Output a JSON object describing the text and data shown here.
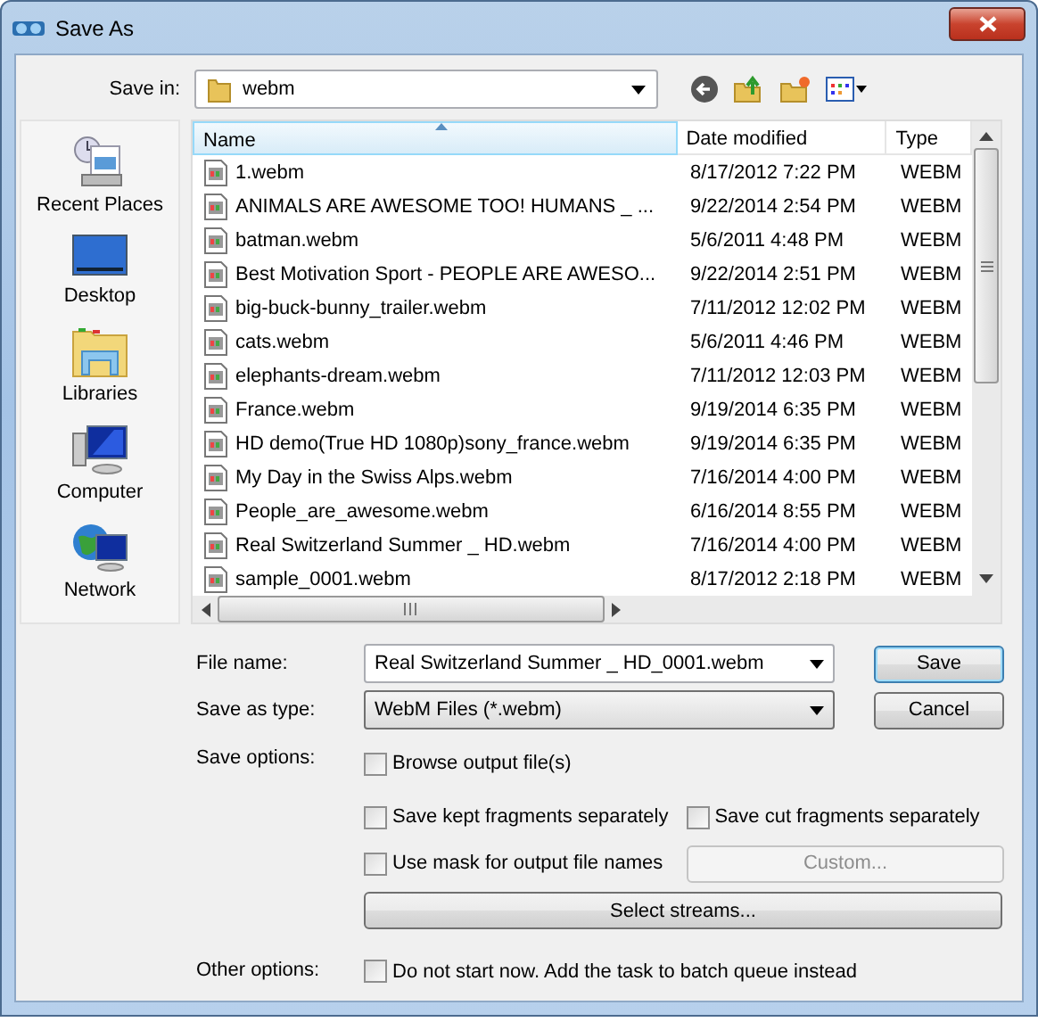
{
  "window": {
    "title": "Save As"
  },
  "save_in": {
    "label": "Save in:",
    "value": "webm"
  },
  "places": [
    {
      "label": "Recent Places",
      "kind": "recent"
    },
    {
      "label": "Desktop",
      "kind": "desktop"
    },
    {
      "label": "Libraries",
      "kind": "libraries"
    },
    {
      "label": "Computer",
      "kind": "computer"
    },
    {
      "label": "Network",
      "kind": "network"
    }
  ],
  "file_list": {
    "columns": [
      {
        "label": "Name",
        "sorted": true
      },
      {
        "label": "Date modified",
        "sorted": false
      },
      {
        "label": "Type",
        "sorted": false
      }
    ],
    "rows": [
      {
        "name": "1.webm",
        "date": "8/17/2012 7:22 PM",
        "type": "WEBM"
      },
      {
        "name": "ANIMALS ARE AWESOME TOO! HUMANS _ ...",
        "date": "9/22/2014 2:54 PM",
        "type": "WEBM"
      },
      {
        "name": "batman.webm",
        "date": "5/6/2011 4:48 PM",
        "type": "WEBM"
      },
      {
        "name": "Best Motivation Sport - PEOPLE ARE AWESO...",
        "date": "9/22/2014 2:51 PM",
        "type": "WEBM"
      },
      {
        "name": "big-buck-bunny_trailer.webm",
        "date": "7/11/2012 12:02 PM",
        "type": "WEBM"
      },
      {
        "name": "cats.webm",
        "date": "5/6/2011 4:46 PM",
        "type": "WEBM"
      },
      {
        "name": "elephants-dream.webm",
        "date": "7/11/2012 12:03 PM",
        "type": "WEBM"
      },
      {
        "name": "France.webm",
        "date": "9/19/2014 6:35 PM",
        "type": "WEBM"
      },
      {
        "name": "HD demo(True HD 1080p)sony_france.webm",
        "date": "9/19/2014 6:35 PM",
        "type": "WEBM"
      },
      {
        "name": "My Day in the Swiss Alps.webm",
        "date": "7/16/2014 4:00 PM",
        "type": "WEBM"
      },
      {
        "name": "People_are_awesome.webm",
        "date": "6/16/2014 8:55 PM",
        "type": "WEBM"
      },
      {
        "name": "Real Switzerland Summer _ HD.webm",
        "date": "7/16/2014 4:00 PM",
        "type": "WEBM"
      },
      {
        "name": "sample_0001.webm",
        "date": "8/17/2012 2:18 PM",
        "type": "WEBM"
      }
    ]
  },
  "file_name": {
    "label": "File name:",
    "value": "Real Switzerland Summer _ HD_0001.webm"
  },
  "save_as_type": {
    "label": "Save as type:",
    "value": "WebM Files (*.webm)"
  },
  "buttons": [
    {
      "label": "Save",
      "default": true
    },
    {
      "label": "Cancel",
      "default": false
    }
  ],
  "save_options": {
    "label": "Save options:",
    "browse": {
      "label": "Browse output file(s)",
      "checked": false
    },
    "kept": {
      "label": "Save kept fragments separately",
      "checked": false
    },
    "cut": {
      "label": "Save cut fragments separately",
      "checked": false
    },
    "mask": {
      "label": "Use mask for output file names",
      "checked": false
    },
    "custom": {
      "label": "Custom...",
      "disabled": true
    },
    "streams": {
      "label": "Select streams...",
      "disabled": false
    }
  },
  "other_options": {
    "label": "Other options:",
    "batch": {
      "label": "Do not start now. Add the task to batch queue instead",
      "checked": false
    }
  }
}
